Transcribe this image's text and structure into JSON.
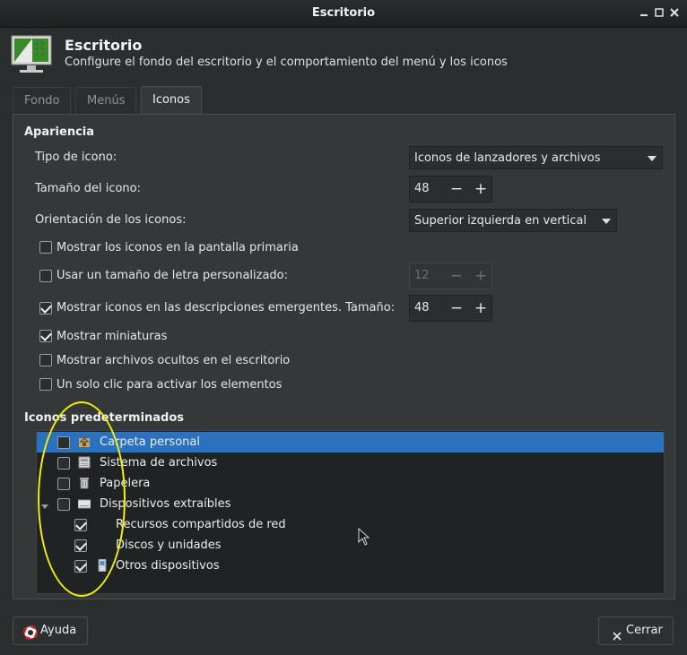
{
  "window": {
    "title": "Escritorio"
  },
  "header": {
    "title": "Escritorio",
    "subtitle": "Configure el fondo del escritorio y el comportamiento del menú y los iconos"
  },
  "tabs": [
    {
      "label": "Fondo",
      "active": false
    },
    {
      "label": "Menús",
      "active": false
    },
    {
      "label": "Iconos",
      "active": true
    }
  ],
  "appearance": {
    "section_title": "Apariencia",
    "icon_type_label": "Tipo de icono:",
    "icon_type_value": "Iconos de lanzadores y archivos",
    "icon_size_label": "Tamaño del icono:",
    "icon_size_value": "48",
    "orientation_label": "Orientación de los iconos:",
    "orientation_value": "Superior izquierda en vertical",
    "primary_screen_label": "Mostrar los iconos en la pantalla primaria",
    "custom_font_label": "Usar un tamaño de letra personalizado:",
    "custom_font_value": "12",
    "tooltips_label": "Mostrar iconos en las descripciones emergentes. Tamaño:",
    "tooltips_value": "48",
    "thumbnails_label": "Mostrar miniaturas",
    "hidden_files_label": "Mostrar archivos ocultos en el escritorio",
    "single_click_label": "Un solo clic para activar los elementos"
  },
  "default_icons": {
    "section_title": "Iconos predeterminados",
    "items": [
      {
        "label": "Carpeta personal",
        "checked": false,
        "icon": "home-folder-icon"
      },
      {
        "label": "Sistema de archivos",
        "checked": false,
        "icon": "filesystem-icon"
      },
      {
        "label": "Papelera",
        "checked": false,
        "icon": "trash-icon"
      },
      {
        "label": "Dispositivos extraíbles",
        "checked": false,
        "icon": "removable-drive-icon"
      },
      {
        "label": "Recursos compartidos de red",
        "checked": true,
        "icon": ""
      },
      {
        "label": "Discos y unidades",
        "checked": true,
        "icon": ""
      },
      {
        "label": "Otros dispositivos",
        "checked": true,
        "icon": "device-icon"
      }
    ]
  },
  "buttons": {
    "help": "Ayuda",
    "close": "Cerrar"
  },
  "colors": {
    "selection": "#2a72c0",
    "highlight_ellipse": "#f2f200"
  }
}
